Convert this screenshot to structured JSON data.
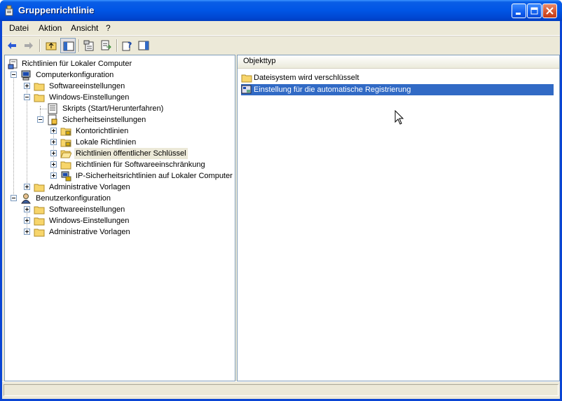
{
  "window": {
    "title": "Gruppenrichtlinie"
  },
  "menu": [
    "Datei",
    "Aktion",
    "Ansicht",
    "?"
  ],
  "toolbar": {
    "buttons": [
      "back",
      "forward",
      "up-one-level",
      "show-hide-console-tree",
      "properties",
      "export-list",
      "help",
      "show-hide-action-pane"
    ]
  },
  "tree": {
    "root": "Richtlinien für Lokaler Computer",
    "computer": "Computerkonfiguration",
    "c_software": "Softwareeinstellungen",
    "c_windows": "Windows-Einstellungen",
    "c_scripts": "Skripts (Start/Herunterfahren)",
    "c_security": "Sicherheitseinstellungen",
    "c_account": "Kontorichtlinien",
    "c_local": "Lokale Richtlinien",
    "c_publickey": "Richtlinien öffentlicher Schlüssel",
    "c_softrestrict": "Richtlinien für Softwareeinschränkung",
    "c_ipsec": "IP-Sicherheitsrichtlinien auf Lokaler Computer",
    "c_admin": "Administrative Vorlagen",
    "user": "Benutzerkonfiguration",
    "u_software": "Softwareeinstellungen",
    "u_windows": "Windows-Einstellungen",
    "u_admin": "Administrative Vorlagen"
  },
  "list": {
    "column": "Objekttyp",
    "items": [
      "Dateisystem wird verschlüsselt",
      "Einstellung für die automatische Registrierung"
    ]
  },
  "colors": {
    "selection": "#316ac5",
    "titlebar": "#0055e5",
    "folder": "#f7d56b"
  }
}
